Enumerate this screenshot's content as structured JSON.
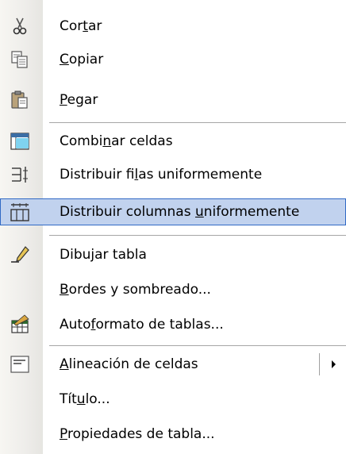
{
  "menu": {
    "items": [
      {
        "id": "cortar",
        "pre": "Cor",
        "ak": "t",
        "post": "ar",
        "icon": "scissors-icon"
      },
      {
        "id": "copiar",
        "pre": "",
        "ak": "C",
        "post": "opiar",
        "icon": "copy-icon"
      },
      {
        "id": "pegar",
        "pre": "",
        "ak": "P",
        "post": "egar",
        "icon": "paste-icon"
      },
      {
        "id": "combinar",
        "pre": "Combi",
        "ak": "n",
        "post": "ar celdas",
        "icon": "merge-cells-icon"
      },
      {
        "id": "distribuir-filas",
        "pre": "Distribuir fi",
        "ak": "l",
        "post": "as uniformemente",
        "icon": "distribute-rows-icon"
      },
      {
        "id": "distribuir-columnas",
        "pre": "Distribuir columnas ",
        "ak": "u",
        "post": "niformemente",
        "icon": "distribute-columns-icon"
      },
      {
        "id": "dibujar",
        "pre": "Dibu",
        "ak": "j",
        "post": "ar tabla",
        "icon": "pencil-icon"
      },
      {
        "id": "bordes",
        "pre": "",
        "ak": "B",
        "post": "ordes y sombreado...",
        "icon": ""
      },
      {
        "id": "autoformato",
        "pre": "Auto",
        "ak": "f",
        "post": "ormato de tablas...",
        "icon": "table-autoformat-icon"
      },
      {
        "id": "alineacion",
        "pre": "",
        "ak": "A",
        "post": "lineación de celdas",
        "icon": "align-icon"
      },
      {
        "id": "titulo",
        "pre": "Tít",
        "ak": "u",
        "post": "lo...",
        "icon": ""
      },
      {
        "id": "propiedades",
        "pre": "",
        "ak": "P",
        "post": "ropiedades de tabla...",
        "icon": ""
      }
    ],
    "highlighted_item": "distribuir-columnas",
    "submenu_item": "alineacion",
    "colors": {
      "highlight_bg": "#c1d2ee",
      "highlight_border": "#316ac5",
      "gutter": "#eeedea"
    }
  }
}
